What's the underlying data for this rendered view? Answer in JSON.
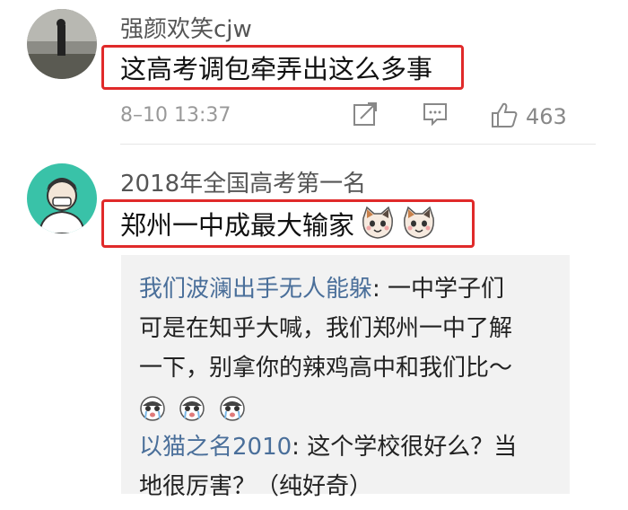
{
  "comments": [
    {
      "username": "强颜欢笑cjw",
      "text": "这高考调包牵弄出这么多事",
      "timestamp": "8–10 13:37",
      "likes": "463"
    },
    {
      "username": "2018年全国高考第一名",
      "text": "郑州一中成最大输家"
    }
  ],
  "replies": [
    {
      "user": "我们波澜出手无人能躲",
      "line1": ": 一中学子们",
      "line2": "可是在知乎大喊，我们郑州一中了解",
      "line3": "一下，别拿你的辣鸡高中和我们比～"
    },
    {
      "user": "以猫之名2010",
      "line1": ": 这个学校很好么？当",
      "line2": "地很厉害？（纯好奇）"
    }
  ],
  "icons": [
    "share-icon",
    "reply-icon",
    "thumbs-up-icon",
    "cat-emoji-icon",
    "crying-emoji-icon"
  ],
  "colors": {
    "highlight_border": "#e02a2a",
    "reply_user": "#4a6f9a",
    "reply_bg": "#f2f2f2"
  }
}
